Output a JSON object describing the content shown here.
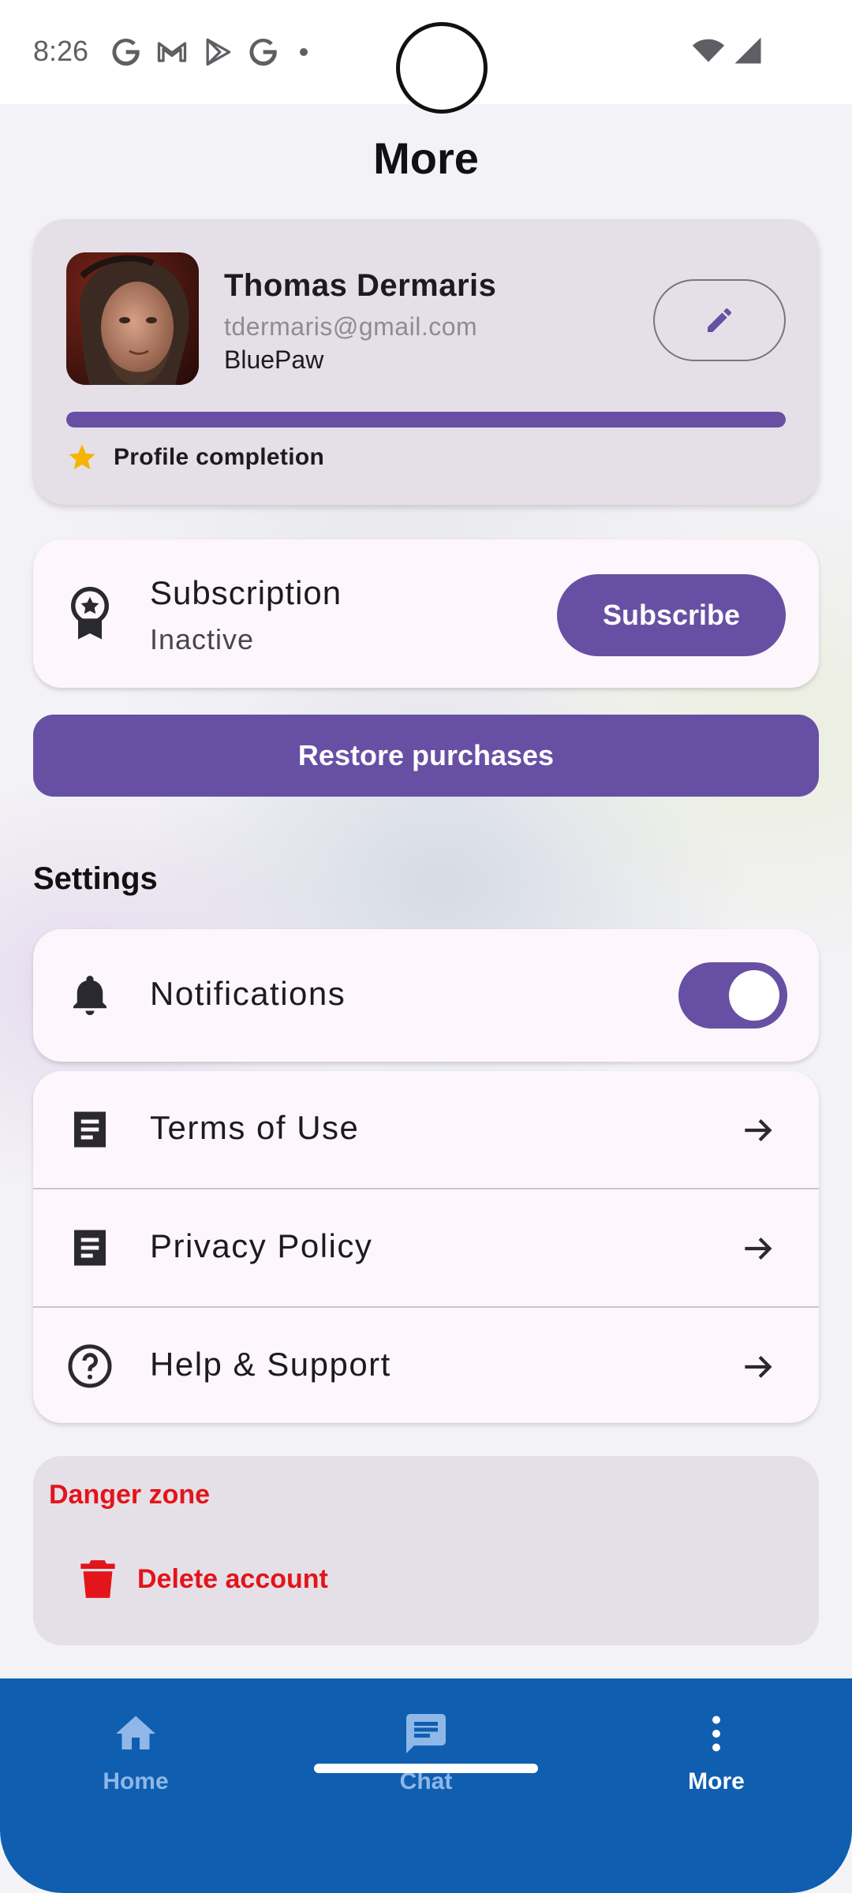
{
  "status_bar": {
    "time": "8:26",
    "icons": [
      "google-g-icon",
      "gmail-icon",
      "play-store-icon",
      "google-g-icon",
      "dot-icon"
    ],
    "right_icons": [
      "wifi-icon",
      "signal-icon"
    ]
  },
  "page": {
    "title": "More"
  },
  "profile": {
    "name": "Thomas Dermaris",
    "email": "tdermaris@gmail.com",
    "company": "BluePaw",
    "completion_label": "Profile completion",
    "completion_fraction": 1.0
  },
  "subscription": {
    "title": "Subscription",
    "status": "Inactive",
    "subscribe_label": "Subscribe",
    "restore_label": "Restore purchases"
  },
  "settings": {
    "heading": "Settings",
    "notifications_label": "Notifications",
    "notifications_enabled": true,
    "links": [
      {
        "label": "Terms of Use",
        "icon": "document-icon"
      },
      {
        "label": "Privacy Policy",
        "icon": "document-icon"
      },
      {
        "label": "Help & Support",
        "icon": "help-circle-icon"
      }
    ]
  },
  "danger_zone": {
    "title": "Danger zone",
    "delete_label": "Delete account"
  },
  "bottom_nav": {
    "items": [
      {
        "label": "Home",
        "icon": "home-icon",
        "active": false
      },
      {
        "label": "Chat",
        "icon": "chat-icon",
        "active": false
      },
      {
        "label": "More",
        "icon": "more-vertical-icon",
        "active": true
      }
    ]
  },
  "colors": {
    "accent": "#6750a4",
    "danger": "#e3141b",
    "nav_background": "#0f5eb0",
    "star": "#f5b400"
  }
}
